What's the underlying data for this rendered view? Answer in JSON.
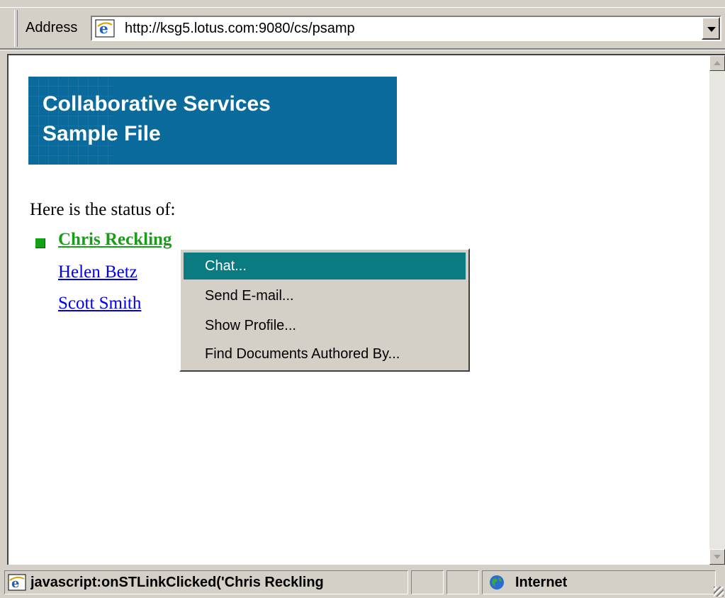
{
  "address_bar": {
    "label": "Address",
    "url": "http://ksg5.lotus.com:9080/cs/psamp",
    "page_icon": "ie-page-icon",
    "dropdown_icon": "chevron-down-icon"
  },
  "page": {
    "banner": {
      "line1": "Collaborative Services",
      "line2": "Sample File",
      "background_color": "#0a6a9c"
    },
    "intro": "Here is the status of:",
    "people": [
      {
        "name": "Chris Reckling",
        "online": true,
        "color": "#1a9c1a"
      },
      {
        "name": " Helen Betz",
        "online": false,
        "color": "#0000ee"
      },
      {
        "name": " Scott Smith",
        "online": false,
        "color": "#0000ee"
      }
    ]
  },
  "context_menu": {
    "items": [
      {
        "label": "Chat...",
        "selected": true
      },
      {
        "label": "Send E-mail...",
        "selected": false
      },
      {
        "label": "Show Profile...",
        "selected": false
      },
      {
        "label": "Find Documents Authored By...",
        "selected": false
      }
    ],
    "selected_color": "#0b7b82"
  },
  "status_bar": {
    "text": "javascript:onSTLinkClicked('Chris Reckling",
    "zone": "Internet",
    "page_icon": "ie-page-icon",
    "zone_icon": "globe-icon"
  }
}
